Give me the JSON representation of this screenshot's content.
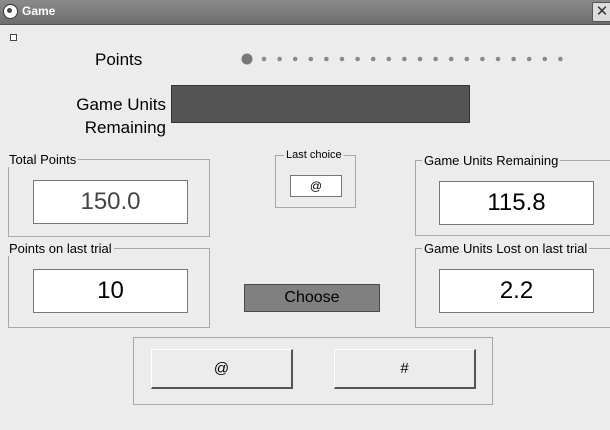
{
  "window": {
    "title": "Game",
    "close_glyph": "✕"
  },
  "labels": {
    "points": "Points",
    "game_units_line1": "Game Units",
    "game_units_line2": "Remaining"
  },
  "progress": {
    "dot_count": 20,
    "progress_fraction": 0
  },
  "game_units_bar": {
    "color": "#555555"
  },
  "total_points": {
    "legend": "Total Points",
    "value": "150.0"
  },
  "last_choice": {
    "legend": "Last choice",
    "value": "@"
  },
  "game_units_remaining": {
    "legend": "Game Units Remaining",
    "value": "115.8"
  },
  "points_last_trial": {
    "legend": "Points on last trial",
    "value": "10"
  },
  "choose": {
    "label": "Choose"
  },
  "units_lost_last_trial": {
    "legend": "Game Units Lost on last trial",
    "value": "2.2"
  },
  "options": {
    "at_label": "@",
    "hash_label": "#"
  }
}
